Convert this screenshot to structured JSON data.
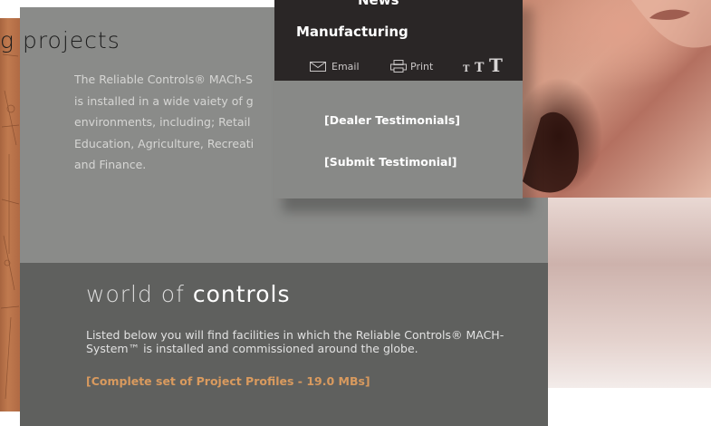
{
  "section": {
    "heading_fragment": "g projects",
    "intro_lines": [
      "The Reliable Controls® MACh-S",
      "is installed in a wide vaiety of g",
      "environments, including; Retail",
      "Education, Agriculture, Recreati",
      "and Finance."
    ]
  },
  "menu": {
    "news": "News",
    "manufacturing": "Manufacturing",
    "email": "Email",
    "print": "Print",
    "text_size": [
      "T",
      "T",
      "T"
    ],
    "dealer_testimonials": "[Dealer Testimonials]",
    "submit_testimonial": "[Submit Testimonial]"
  },
  "world": {
    "heading_light": "world of",
    "heading_emph": "controls",
    "description": "Listed below you will find facilities in which the Reliable Controls® MACH-System™ is installed and commissioned around the globe.",
    "profiles_link": "[Complete set of Project Profiles - 19.0 MBs]"
  },
  "colors": {
    "panel_upper": "#8a8b89",
    "panel_lower": "#5f605e",
    "menu_dark": "#2a2626",
    "link_accent": "#d99a5e"
  }
}
